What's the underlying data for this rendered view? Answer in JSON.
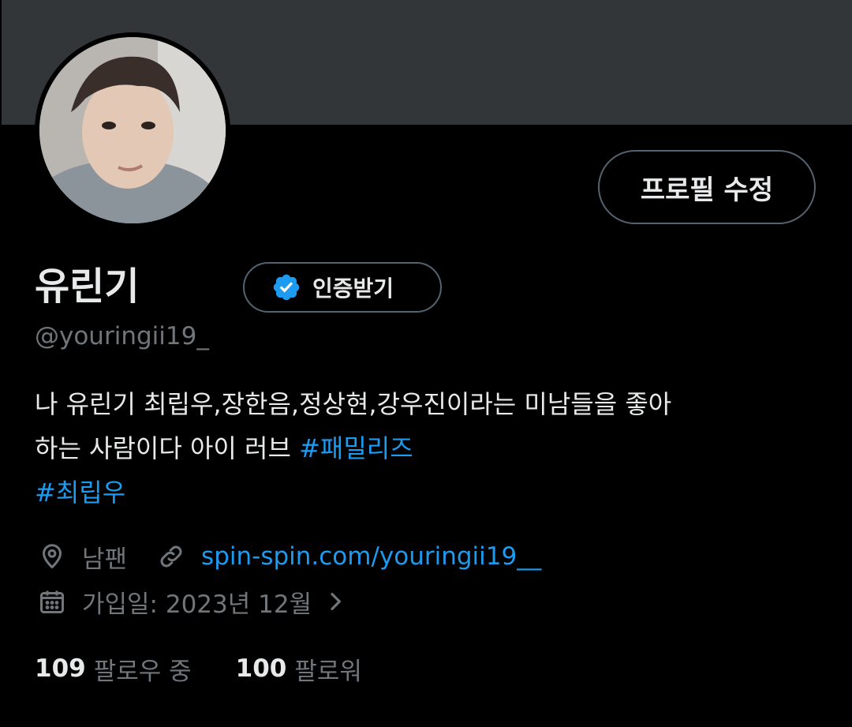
{
  "profile": {
    "display_name": "유린기",
    "verify_label": "인증받기",
    "handle": "@youringii19_",
    "edit_label": "프로필 수정",
    "bio": {
      "line1": "나 유린기 최립우,장한음,정상현,강우진이라는 미남들을 좋아",
      "line2_text": "하는 사람이다 아이 러브 ",
      "hashtag1": "#패밀리즈",
      "hashtag2": "#최립우"
    },
    "location": "남팬",
    "website": "spin-spin.com/youringii19__",
    "joined": "가입일: 2023년 12월",
    "following_count": "109",
    "following_label": "팔로우 중",
    "followers_count": "100",
    "followers_label": "팔로워"
  },
  "icons": {
    "location": "map-pin-icon",
    "link": "link-icon",
    "calendar": "calendar-icon",
    "chevron": "chevron-right-icon",
    "verified": "verified-badge-icon"
  },
  "colors": {
    "accent": "#1d9bf0",
    "muted": "#71767b",
    "banner": "#333639",
    "border": "#536471"
  }
}
